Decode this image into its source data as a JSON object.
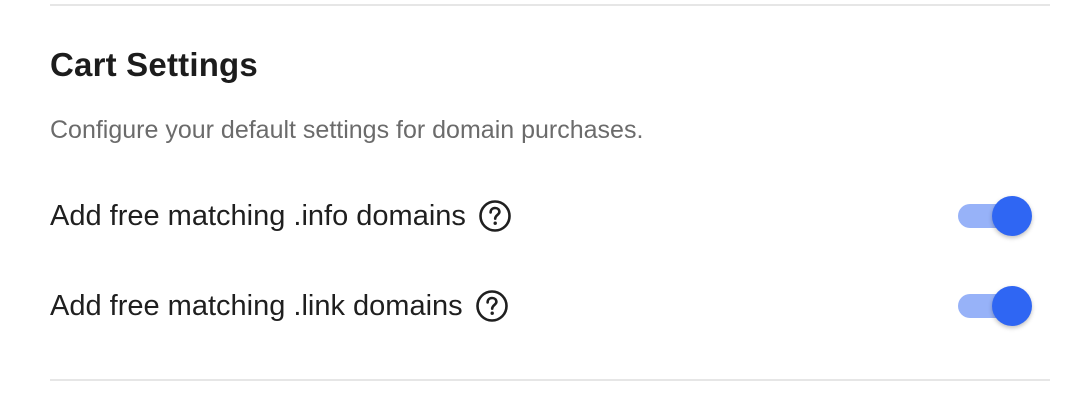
{
  "cart_settings": {
    "title": "Cart Settings",
    "description": "Configure your default settings for domain purchases.",
    "settings": [
      {
        "label": "Add free matching .info domains",
        "help_icon": "question-circle-icon",
        "enabled": true
      },
      {
        "label": "Add free matching .link domains",
        "help_icon": "question-circle-icon",
        "enabled": true
      }
    ]
  },
  "colors": {
    "toggle_on_knob": "#2f66f3",
    "toggle_on_track": "#97b2f8",
    "divider": "#e6e6e6",
    "description_text": "#6b6b6b"
  }
}
